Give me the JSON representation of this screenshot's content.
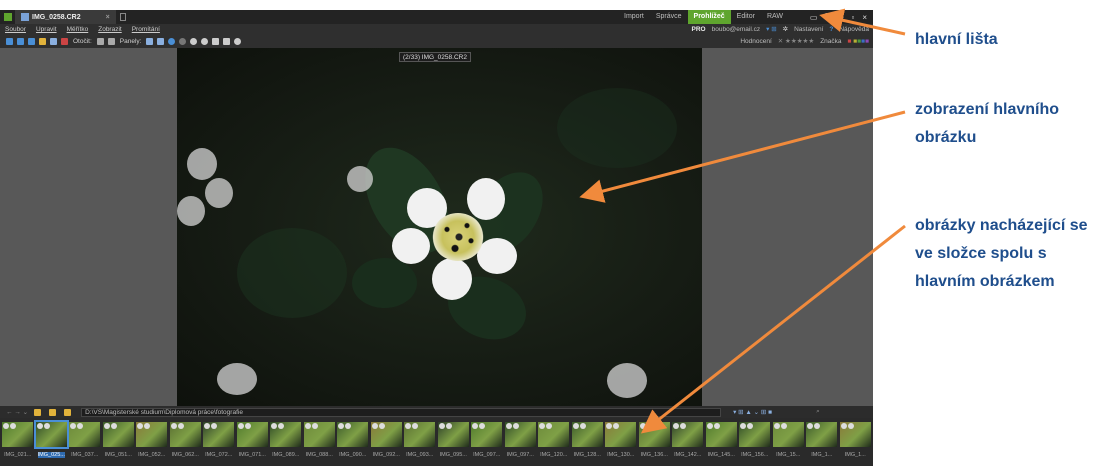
{
  "window": {
    "title": "IMG_0258.CR2"
  },
  "modes": [
    {
      "label": "Import",
      "active": false
    },
    {
      "label": "Správce",
      "active": false
    },
    {
      "label": "Prohlížeč",
      "active": true
    },
    {
      "label": "Editor",
      "active": false
    },
    {
      "label": "RAW",
      "active": false
    }
  ],
  "menu": [
    "Soubor",
    "Upravit",
    "Měřítko",
    "Zobrazit",
    "Promítání"
  ],
  "toolbar": {
    "rotate_label": "Otočit:",
    "panels_label": "Panely:"
  },
  "account": {
    "pro": "PRO",
    "email": "boubo@email.cz",
    "settings": "Nastavení",
    "help": "Nápověda",
    "rating": "Hodnocení",
    "tag": "Značka"
  },
  "photo": {
    "label": "(2/33) IMG_0258.CR2"
  },
  "path": {
    "value": "D:\\VS\\Magisterské studium\\Diplomová práce\\fotografie"
  },
  "thumbnails": [
    {
      "label": "IMG_021...",
      "selected": false
    },
    {
      "label": "IMG_025...",
      "selected": true
    },
    {
      "label": "IMG_037...",
      "selected": false
    },
    {
      "label": "IMG_051...",
      "selected": false
    },
    {
      "label": "IMG_052...",
      "selected": false
    },
    {
      "label": "IMG_062...",
      "selected": false
    },
    {
      "label": "IMG_072...",
      "selected": false
    },
    {
      "label": "IMG_071...",
      "selected": false
    },
    {
      "label": "IMG_089...",
      "selected": false
    },
    {
      "label": "IMG_088...",
      "selected": false
    },
    {
      "label": "IMG_090...",
      "selected": false
    },
    {
      "label": "IMG_092...",
      "selected": false
    },
    {
      "label": "IMG_093...",
      "selected": false
    },
    {
      "label": "IMG_095...",
      "selected": false
    },
    {
      "label": "IMG_097...",
      "selected": false
    },
    {
      "label": "IMG_097...",
      "selected": false
    },
    {
      "label": "IMG_120...",
      "selected": false
    },
    {
      "label": "IMG_128...",
      "selected": false
    },
    {
      "label": "IMG_130...",
      "selected": false
    },
    {
      "label": "IMG_136...",
      "selected": false
    },
    {
      "label": "IMG_142...",
      "selected": false
    },
    {
      "label": "IMG_145...",
      "selected": false
    },
    {
      "label": "IMG_156...",
      "selected": false
    },
    {
      "label": "IMG_15...",
      "selected": false
    },
    {
      "label": "IMG_1...",
      "selected": false
    },
    {
      "label": "IMG_1...",
      "selected": false
    },
    {
      "label": "IMG_1...",
      "selected": false
    }
  ],
  "annotations": {
    "main_bar": "hlavní lišta",
    "main_image": "zobrazení hlavního obrázku",
    "folder_images": "obrázky nacházející se ve složce spolu s hlavním obrázkem"
  },
  "colors": {
    "accent": "#5fa52e",
    "annotation_text": "#1f4e8c",
    "arrow": "#f08a3c"
  }
}
